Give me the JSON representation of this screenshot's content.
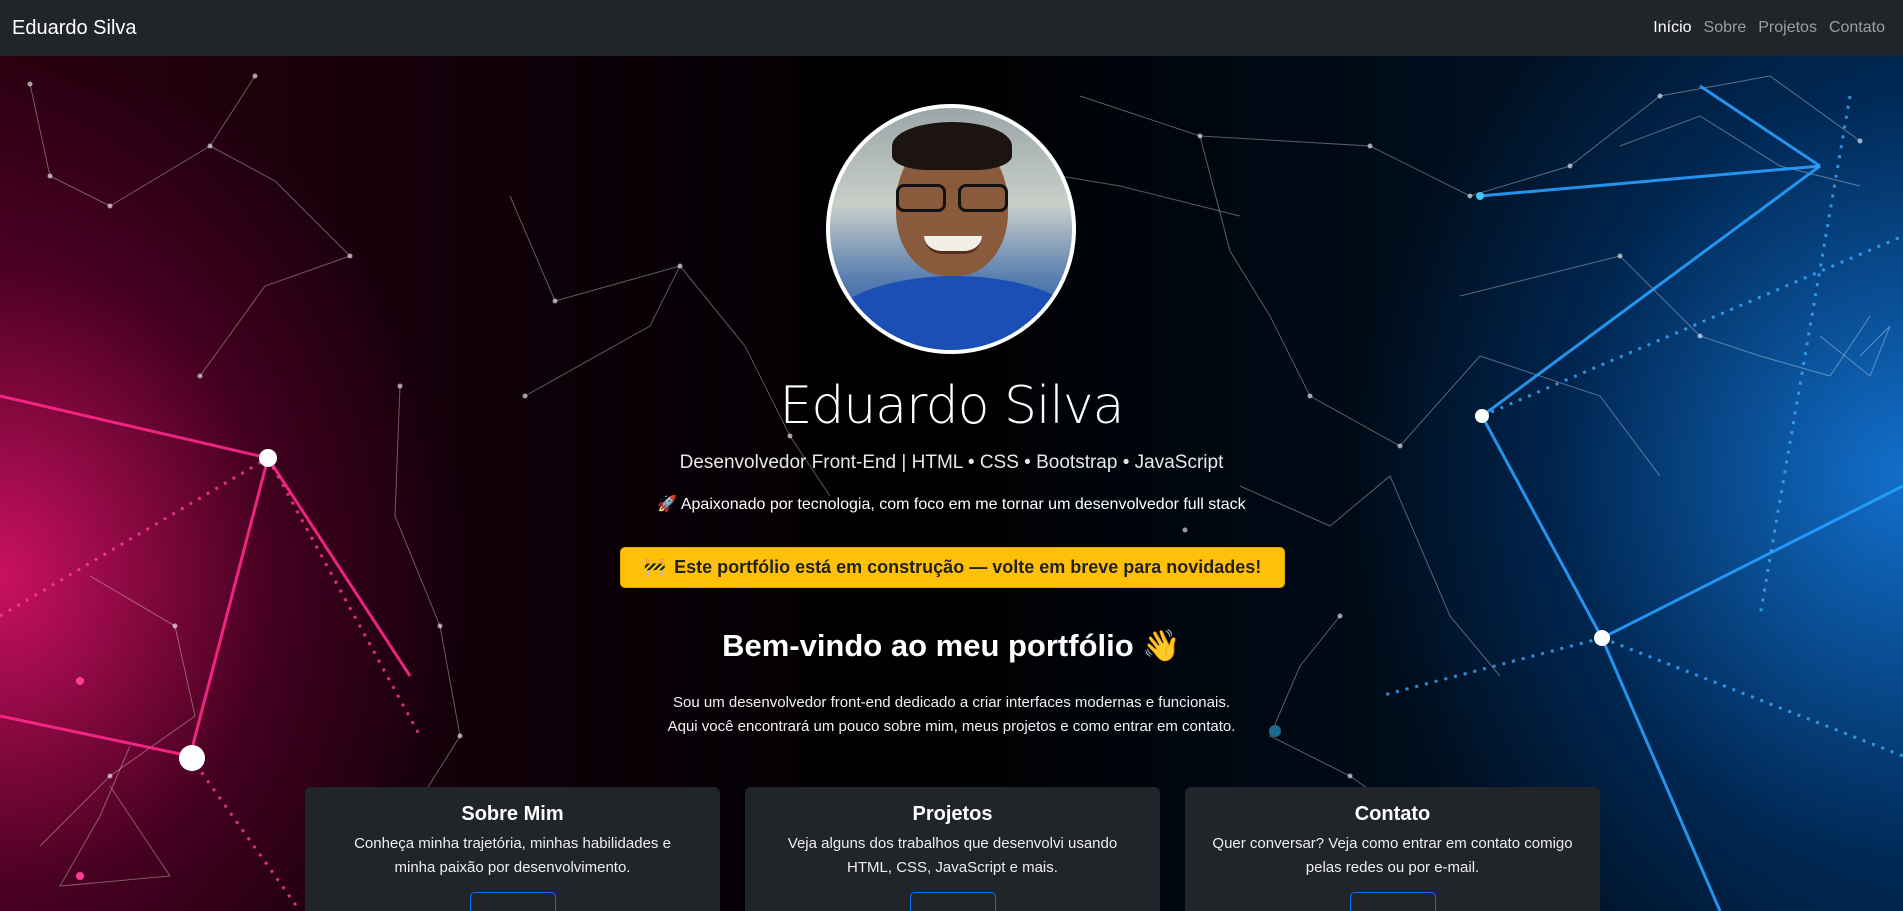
{
  "navbar": {
    "brand": "Eduardo Silva",
    "links": [
      {
        "label": "Início",
        "active": true
      },
      {
        "label": "Sobre",
        "active": false
      },
      {
        "label": "Projetos",
        "active": false
      },
      {
        "label": "Contato",
        "active": false
      }
    ]
  },
  "hero": {
    "name": "Eduardo Silva",
    "subtitle": "Desenvolvedor Front-End | HTML • CSS • Bootstrap • JavaScript",
    "tagline_icon": "🚀",
    "tagline": "Apaixonado por tecnologia, com foco em me tornar um desenvolvedor full stack",
    "banner_icon": "🚧",
    "banner": "Este portfólio está em construção — volte em breve para novidades!",
    "welcome": "Bem-vindo ao meu portfólio",
    "welcome_icon": "👋",
    "intro_line1": "Sou um desenvolvedor front-end dedicado a criar interfaces modernas e funcionais.",
    "intro_line2": "Aqui você encontrará um pouco sobre mim, meus projetos e como entrar em contato."
  },
  "cards": [
    {
      "title": "Sobre Mim",
      "text_line1": "Conheça minha trajetória, minhas habilidades e",
      "text_line2": "minha paixão por desenvolvimento."
    },
    {
      "title": "Projetos",
      "text_line1": "Veja alguns dos trabalhos que desenvolvi usando",
      "text_line2": "HTML, CSS, JavaScript e mais."
    },
    {
      "title": "Contato",
      "text_line1": "Quer conversar? Veja como entrar em contato comigo",
      "text_line2": "pelas redes ou por e-mail."
    }
  ],
  "colors": {
    "navbar_bg": "#212529",
    "banner_bg": "#ffc107",
    "card_bg": "#212529",
    "accent_pink": "#e6146e",
    "accent_blue": "#1478dc",
    "button_border": "#0d6efd"
  }
}
